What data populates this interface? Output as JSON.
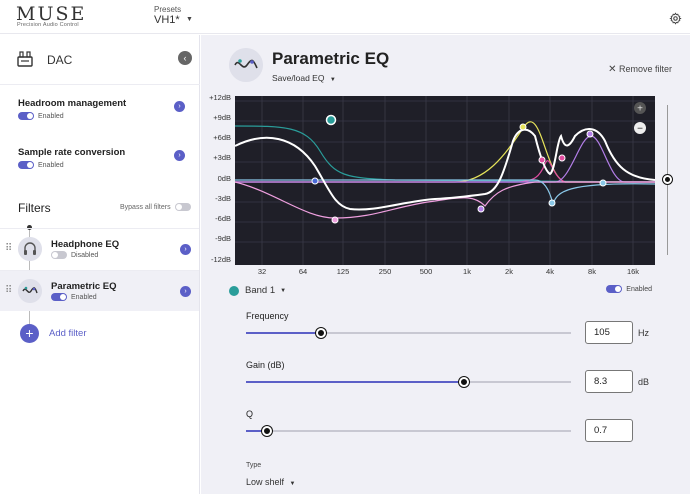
{
  "header": {
    "logo": "MUSE",
    "logo_sub": "Precision Audio Control",
    "presets_label": "Presets",
    "presets_value": "VH1*",
    "settings_icon": "gear-icon"
  },
  "sidebar": {
    "dac_label": "DAC",
    "settings": [
      {
        "title": "Headroom management",
        "status": "Enabled",
        "enabled": true
      },
      {
        "title": "Sample rate conversion",
        "status": "Enabled",
        "enabled": true
      }
    ],
    "filters_title": "Filters",
    "bypass_label": "Bypass all filters",
    "bypass_enabled": false,
    "filters": [
      {
        "name": "Headphone EQ",
        "status": "Disabled",
        "enabled": false,
        "icon": "headphone-icon"
      },
      {
        "name": "Parametric EQ",
        "status": "Enabled",
        "enabled": true,
        "icon": "eq-curve-icon"
      }
    ],
    "add_filter_label": "Add filter"
  },
  "main": {
    "title": "Parametric EQ",
    "saveload": "Save/load EQ",
    "remove_filter": "Remove filter",
    "graph": {
      "y_labels": [
        "+12dB",
        "+9dB",
        "+6dB",
        "+3dB",
        "0dB",
        "-3dB",
        "-6dB",
        "-9dB",
        "-12dB"
      ],
      "x_labels": [
        "32",
        "64",
        "125",
        "250",
        "500",
        "1k",
        "2k",
        "4k",
        "8k",
        "16k"
      ],
      "colors": {
        "background": "#1f1f28",
        "grid": "#3a3a48",
        "total": "#ffffff",
        "band1": "#2a9d9a",
        "band2": "#e6e35a",
        "band3": "#e04ca0",
        "band4": "#b37ee8",
        "band5": "#f0a0e0",
        "band6": "#8ac8e8",
        "zero": "#4a6ad8"
      }
    },
    "band": {
      "label": "Band 1",
      "enabled_label": "Enabled",
      "enabled": true,
      "color": "#2a9d9a"
    },
    "params": {
      "frequency": {
        "label": "Frequency",
        "value": "105",
        "unit": "Hz",
        "fraction": 0.23
      },
      "gain": {
        "label": "Gain (dB)",
        "value": "8.3",
        "unit": "dB",
        "fraction": 0.67
      },
      "q": {
        "label": "Q",
        "value": "0.7",
        "unit": "",
        "fraction": 0.065
      }
    },
    "type": {
      "label": "Type",
      "value": "Low shelf"
    }
  }
}
